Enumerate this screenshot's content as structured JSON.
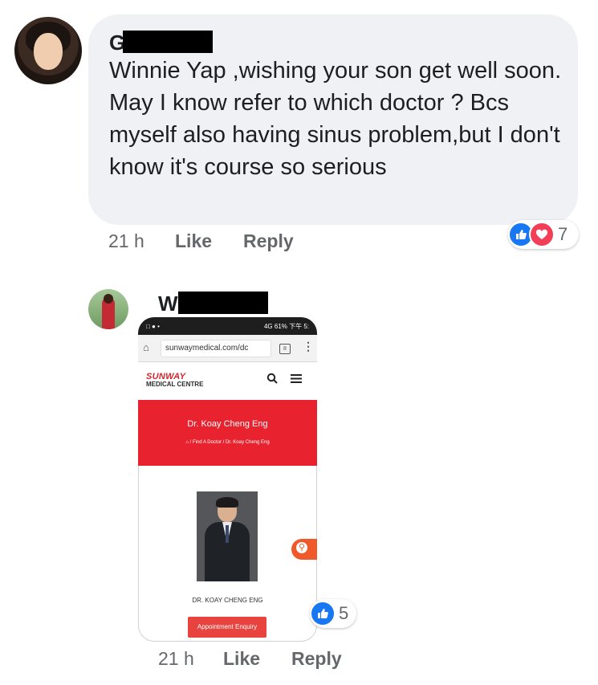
{
  "comment": {
    "author_visible": "G",
    "text": "Winnie Yap ,wishing your son get well soon.\nMay I know refer to which doctor ? Bcs myself also having sinus problem,but I don't know it's course so serious",
    "time": "21 h",
    "like_label": "Like",
    "reply_label": "Reply",
    "reactions": {
      "icons": [
        "like-icon",
        "love-icon"
      ],
      "count": "7"
    }
  },
  "reply": {
    "author_visible": "W",
    "time": "21 h",
    "like_label": "Like",
    "reply_label": "Reply",
    "reactions": {
      "icons": [
        "like-icon"
      ],
      "count": "5"
    },
    "attachment": {
      "status_left": "□ ● •",
      "status_right": "4G 61% 下午 5:",
      "url": "sunwaymedical.com/dc",
      "tab_count": "8",
      "logo_line1": "SUNWAY",
      "logo_line2": "MEDICAL CENTRE",
      "doctor_title": "Dr. Koay Cheng Eng",
      "breadcrumb": "⌂  /  Find A Doctor  /  Dr. Koay Cheng Eng",
      "doctor_name_caps": "DR. KOAY CHENG ENG",
      "button_label": "Appointment Enquiry"
    }
  },
  "colors": {
    "bubble": "#f0f1f4",
    "meta_text": "#65676b",
    "like_blue": "#1877f2",
    "love_red": "#f33e58",
    "sunway_red": "#e8232f"
  }
}
